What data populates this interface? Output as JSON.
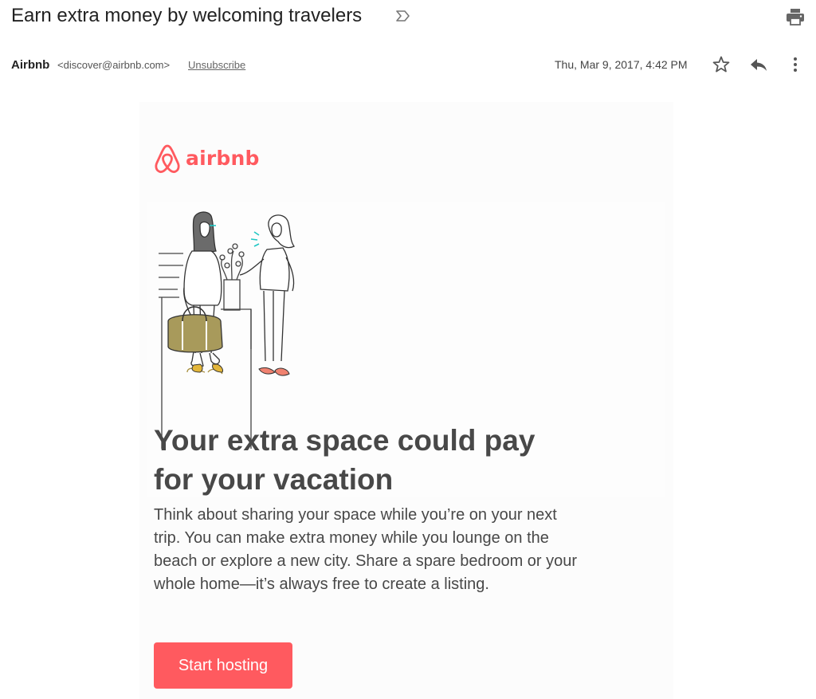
{
  "email": {
    "subject": "Earn extra money by welcoming travelers",
    "sender_name": "Airbnb",
    "sender_email": "<discover@airbnb.com>",
    "unsubscribe_label": "Unsubscribe",
    "date": "Thu, Mar 9, 2017, 4:42 PM"
  },
  "icons": {
    "important": "important-marker-icon",
    "print": "print-icon",
    "star": "star-icon",
    "reply": "reply-icon",
    "more": "more-vertical-icon"
  },
  "content": {
    "logo_text": "airbnb",
    "headline": "Your extra space could pay for your vacation",
    "body": "Think about sharing your space while you’re on your next trip. You can make extra money while you lounge on the beach or explore a new city. Share a spare bedroom or your whole home—it’s always free to create a listing.",
    "cta_label": "Start hosting"
  },
  "colors": {
    "brand": "#ff5a5f",
    "text": "#484848"
  }
}
